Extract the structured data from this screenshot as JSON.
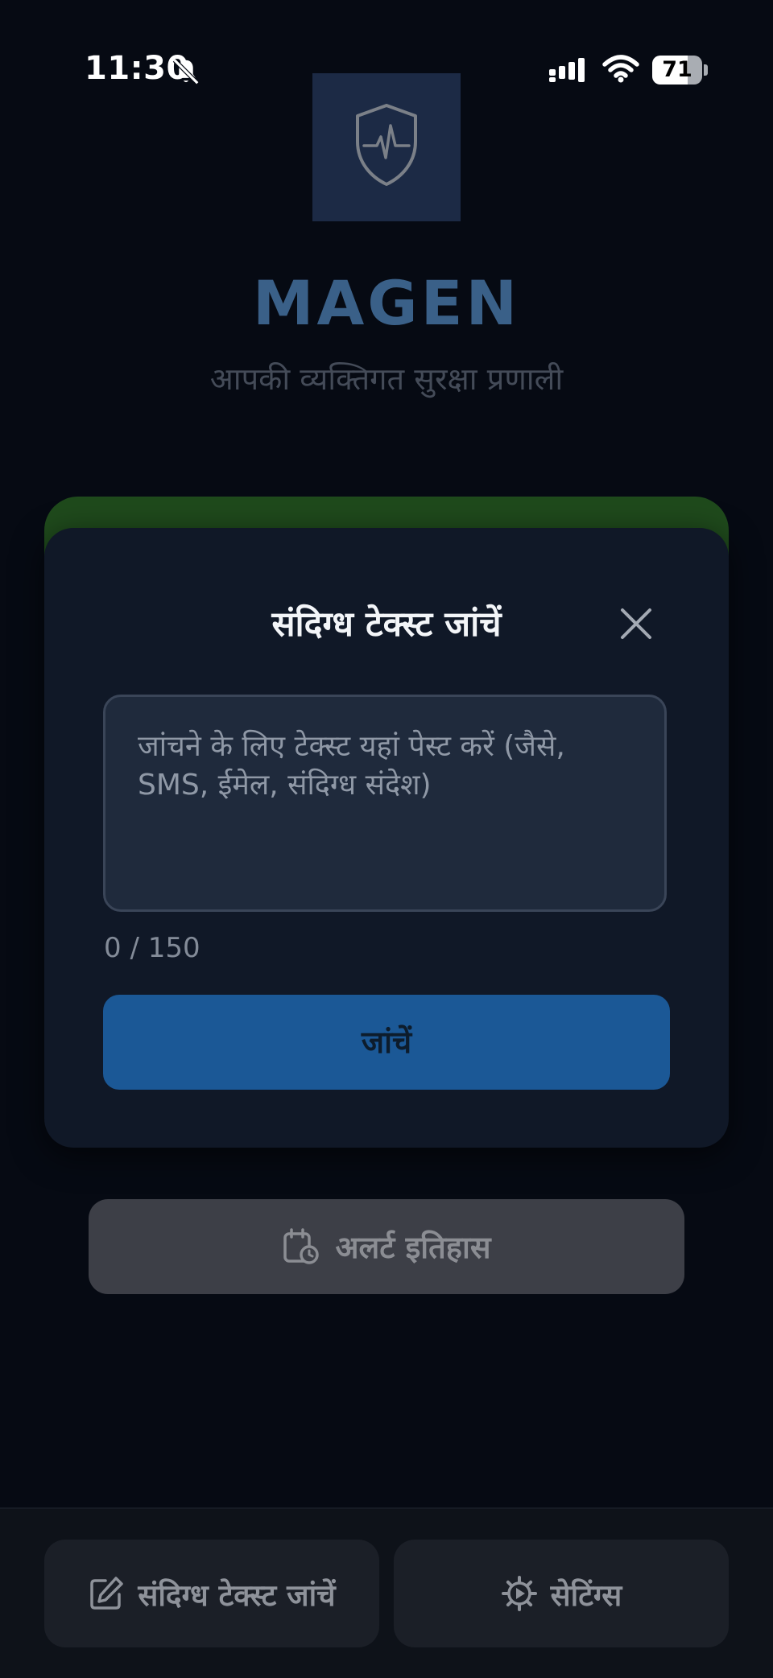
{
  "status_bar": {
    "time": "11:30",
    "battery": "71",
    "battery_fraction": 0.71
  },
  "app": {
    "title": "MAGEN",
    "subtitle": "आपकी व्यक्तिगत सुरक्षा प्रणाली",
    "logo_icon": "shield-heartbeat-icon"
  },
  "modal": {
    "title": "संदिग्ध टेक्स्ट जांचें",
    "input_placeholder": "जांचने के लिए टेक्स्ट यहां पेस्ट करें (जैसे, SMS, ईमेल, संदिग्ध संदेश)",
    "input_value": "",
    "char_count": "0 / 150",
    "check_label": "जांचें"
  },
  "history": {
    "label": "अलर्ट इतिहास",
    "icon": "calendar-clock-icon"
  },
  "bottom_nav": {
    "items": [
      {
        "label": "संदिग्ध टेक्स्ट जांचें",
        "icon": "edit-icon"
      },
      {
        "label": "सेटिंग्स",
        "icon": "gear-icon"
      }
    ]
  },
  "colors": {
    "background": "#060a13",
    "accent": "#1b5896",
    "title": "#3a6088",
    "card_accent": "#1f4a1c"
  }
}
